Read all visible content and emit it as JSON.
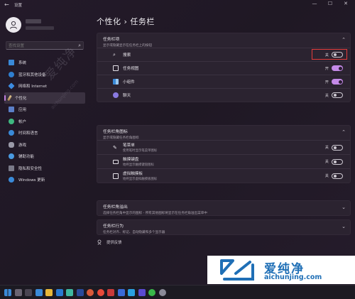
{
  "window": {
    "title": "设置",
    "back": "←",
    "min": "—",
    "max": "☐",
    "close": "✕"
  },
  "sidebar": {
    "search_placeholder": "查找设置",
    "items": [
      {
        "label": "系统",
        "color": "#3a8ad8"
      },
      {
        "label": "蓝牙和其他设备",
        "color": "#2f7fd0"
      },
      {
        "label": "网络和 Internet",
        "color": "#3c8be0"
      },
      {
        "label": "个性化",
        "color": "#d0c9a8"
      },
      {
        "label": "应用",
        "color": "#5b7fc8"
      },
      {
        "label": "帐户",
        "color": "#3fb880"
      },
      {
        "label": "时间和语言",
        "color": "#3a8ad8"
      },
      {
        "label": "游戏",
        "color": "#9a9aa8"
      },
      {
        "label": "辅助功能",
        "color": "#4a9ae0"
      },
      {
        "label": "隐私和安全性",
        "color": "#7a7a88"
      },
      {
        "label": "Windows 更新",
        "color": "#3a8ad8"
      }
    ]
  },
  "page": {
    "title": "个性化 › 任务栏"
  },
  "taskbar_items": {
    "title": "任务栏项",
    "subtitle": "显示或隐藏显示在任务栏上的按钮",
    "rows": [
      {
        "label": "搜索",
        "state": "关",
        "on": false
      },
      {
        "label": "任务视图",
        "state": "开",
        "on": true
      },
      {
        "label": "小组件",
        "state": "开",
        "on": true
      },
      {
        "label": "聊天",
        "state": "关",
        "on": false
      }
    ]
  },
  "corner_icons": {
    "title": "任务栏角图标",
    "subtitle": "显示或隐藏任务栏角图标",
    "rows": [
      {
        "label": "笔菜单",
        "sub": "使用笔时显示笔菜单图标",
        "state": "关",
        "on": false
      },
      {
        "label": "触摸键盘",
        "sub": "始终显示触摸键盘图标",
        "state": "关",
        "on": false
      },
      {
        "label": "虚拟触摸板",
        "sub": "始终显示虚拟触摸板图标",
        "state": "关",
        "on": false
      }
    ]
  },
  "overflow": {
    "title": "任务栏角溢出",
    "subtitle": "选择任务栏角中显示的图标 - 所有其他图标将显示在任务栏角溢出菜单中"
  },
  "behaviors": {
    "title": "任务栏行为",
    "subtitle": "任务栏对齐、标记、自动隐藏和多个显示器"
  },
  "feedback": {
    "label": "提供反馈"
  },
  "watermark": {
    "cn": "爱纯净",
    "url": "aichunjing.com"
  }
}
